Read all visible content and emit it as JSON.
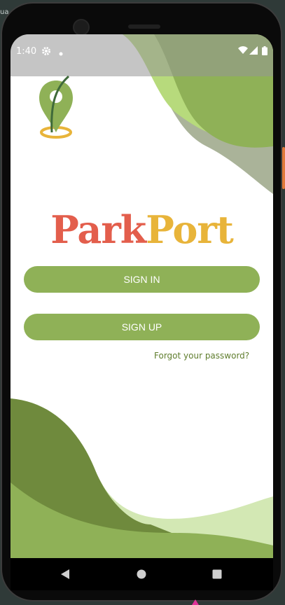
{
  "status_bar": {
    "time": "1:40",
    "icons": [
      "settings-icon",
      "dot-icon",
      "wifi-icon",
      "signal-icon",
      "battery-icon"
    ]
  },
  "desktop_edge_text": "ual",
  "logo": {
    "icon": "map-pin-icon",
    "part1": "Park",
    "part2": "Port"
  },
  "auth": {
    "sign_in_label": "SIGN IN",
    "sign_up_label": "SIGN UP",
    "forgot_label": "Forgot your password?"
  },
  "navigation": {
    "back": "back-icon",
    "home": "home-icon",
    "recents": "recents-icon"
  },
  "colors": {
    "brand_green": "#8fb157",
    "dark_green": "#6f8a3d",
    "light_green": "#b7da7c",
    "park_red": "#e35e4c",
    "port_yellow": "#e8b43a",
    "forgot_text": "#5f7d2d"
  }
}
